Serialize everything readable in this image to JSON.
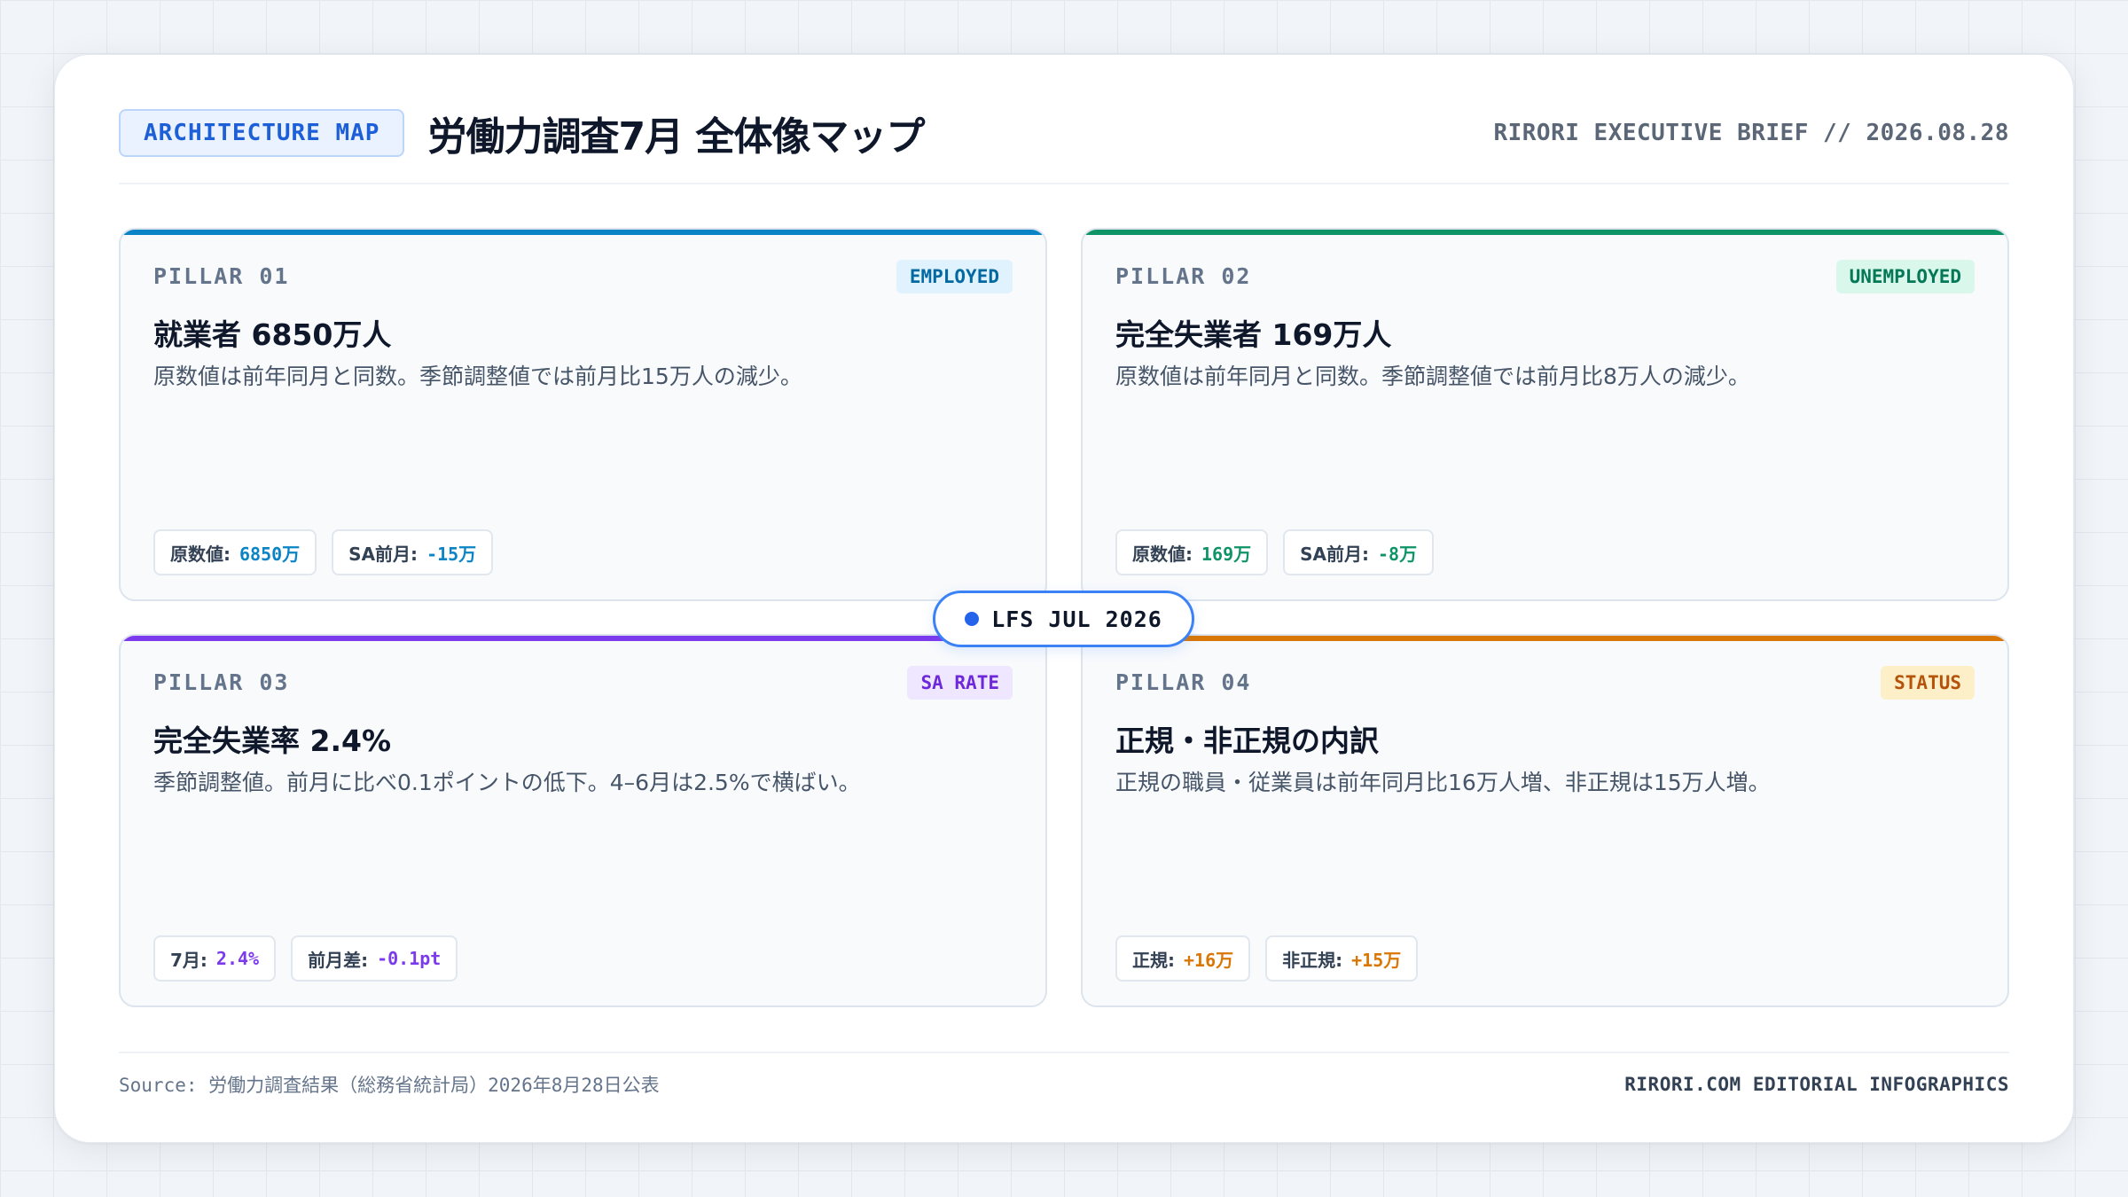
{
  "header": {
    "tag": "ARCHITECTURE MAP",
    "title": "労働力調査7月 全体像マップ",
    "brief": "RIRORI EXECUTIVE BRIEF // 2026.08.28"
  },
  "center": {
    "label": "LFS JUL 2026"
  },
  "pillars": [
    {
      "label": "PILLAR 01",
      "badge": "EMPLOYED",
      "accent": "#0b84c6",
      "badge_bg": "#e0f2fe",
      "badge_fg": "#0369a1",
      "title": "就業者 6850万人",
      "desc": "原数値は前年同月と同数。季節調整値では前月比15万人の減少。",
      "chips": [
        {
          "key": "原数値:",
          "value": "6850万"
        },
        {
          "key": "SA前月:",
          "value": "-15万"
        }
      ],
      "value_color": "#0b84c6"
    },
    {
      "label": "PILLAR 02",
      "badge": "UNEMPLOYED",
      "accent": "#0f9467",
      "badge_bg": "#d9f7ea",
      "badge_fg": "#047857",
      "title": "完全失業者 169万人",
      "desc": "原数値は前年同月と同数。季節調整値では前月比8万人の減少。",
      "chips": [
        {
          "key": "原数値:",
          "value": "169万"
        },
        {
          "key": "SA前月:",
          "value": "-8万"
        }
      ],
      "value_color": "#0f9467"
    },
    {
      "label": "PILLAR 03",
      "badge": "SA RATE",
      "accent": "#7c3aed",
      "badge_bg": "#efe6ff",
      "badge_fg": "#6d28d9",
      "title": "完全失業率 2.4%",
      "desc": "季節調整値。前月に比べ0.1ポイントの低下。4–6月は2.5%で横ばい。",
      "chips": [
        {
          "key": "7月:",
          "value": "2.4%"
        },
        {
          "key": "前月差:",
          "value": "-0.1pt"
        }
      ],
      "value_color": "#7c3aed"
    },
    {
      "label": "PILLAR 04",
      "badge": "STATUS",
      "accent": "#d97706",
      "badge_bg": "#fdf0c8",
      "badge_fg": "#b45309",
      "title": "正規・非正規の内訳",
      "desc": "正規の職員・従業員は前年同月比16万人増、非正規は15万人増。",
      "chips": [
        {
          "key": "正規:",
          "value": "+16万"
        },
        {
          "key": "非正規:",
          "value": "+15万"
        }
      ],
      "value_color": "#d97706"
    }
  ],
  "footer": {
    "source": "Source: 労働力調査結果（総務省統計局）2026年8月28日公表",
    "credit": "RIRORI.COM EDITORIAL INFOGRAPHICS"
  }
}
